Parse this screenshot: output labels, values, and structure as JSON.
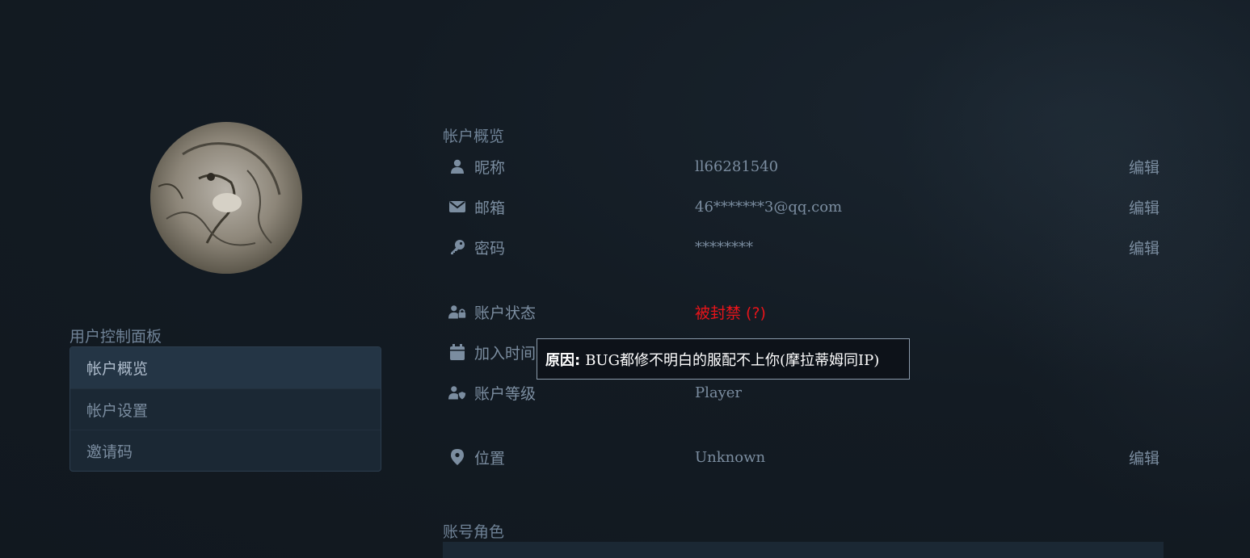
{
  "avatar": {
    "icon": "user-avatar-image"
  },
  "sidebar": {
    "title": "用户控制面板",
    "items": [
      {
        "label": "帐户概览",
        "active": true
      },
      {
        "label": "帐户设置",
        "active": false
      },
      {
        "label": "邀请码",
        "active": false
      }
    ]
  },
  "overview": {
    "title": "帐户概览",
    "nickname": {
      "label": "昵称",
      "value": "ll66281540",
      "edit": "编辑",
      "icon": "user-icon"
    },
    "email": {
      "label": "邮箱",
      "value": "46*******3@qq.com",
      "edit": "编辑",
      "icon": "envelope-icon"
    },
    "password": {
      "label": "密码",
      "value": "********",
      "edit": "编辑",
      "icon": "key-icon"
    },
    "status": {
      "label": "账户状态",
      "value": "被封禁 (?)",
      "icon": "user-lock-icon",
      "color": "#e8141a"
    },
    "joined": {
      "label": "加入时间",
      "value": "",
      "icon": "calendar-icon"
    },
    "level": {
      "label": "账户等级",
      "value": "Player",
      "icon": "user-shield-icon"
    },
    "location": {
      "label": "位置",
      "value": "Unknown",
      "edit": "编辑",
      "icon": "map-marker-icon"
    }
  },
  "tooltip": {
    "prefix": "原因:",
    "text": "BUG都修不明白的服配不上你(摩拉蒂姆同IP)"
  },
  "roles": {
    "title": "账号角色"
  }
}
